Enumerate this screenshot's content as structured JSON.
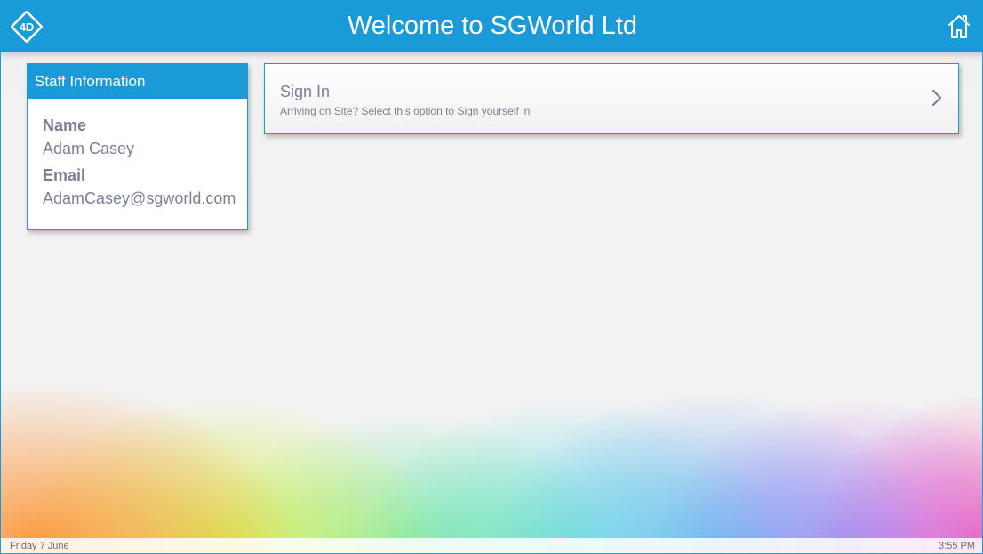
{
  "header": {
    "title": "Welcome to SGWorld Ltd",
    "logo_text": "4D",
    "logo_icon": "4d-logo-icon",
    "home_icon": "home-icon"
  },
  "staff_info": {
    "heading": "Staff Information",
    "name_label": "Name",
    "name_value": "Adam Casey",
    "email_label": "Email",
    "email_value": "AdamCasey@sgworld.com"
  },
  "sign_in": {
    "title": "Sign In",
    "subtitle": "Arriving on Site? Select this option to Sign yourself in",
    "icon": "chevron-right-icon"
  },
  "footer": {
    "date": "Friday 7 June",
    "time": "3:55 PM"
  },
  "colors": {
    "accent": "#1a9ad6",
    "text": "#7a7f94"
  }
}
